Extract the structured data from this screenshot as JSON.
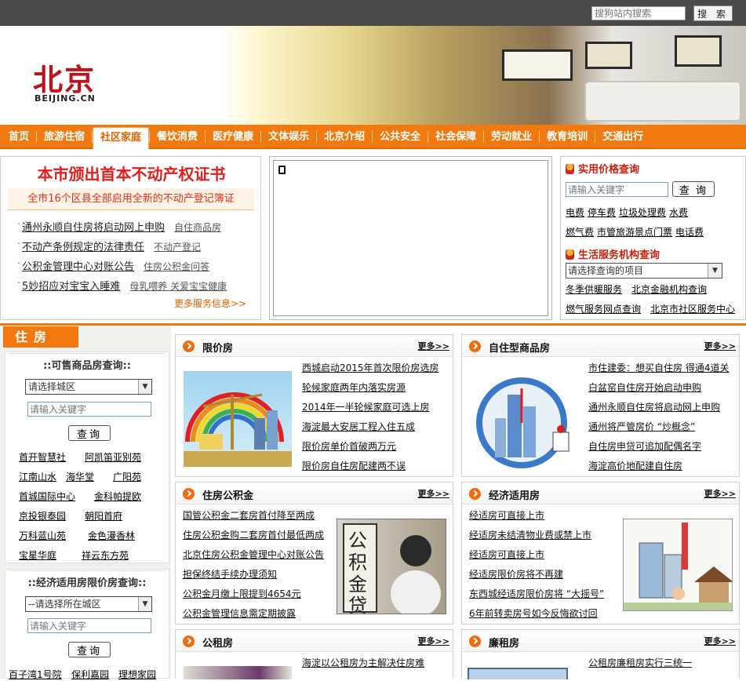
{
  "topbar": {
    "search_placeholder": "搜狗站内搜索",
    "search_button": "搜 索"
  },
  "logo": {
    "cn": "北京",
    "en": "BEIJING.CN"
  },
  "nav": [
    "首页",
    "旅游住宿",
    "社区家庭",
    "餐饮消费",
    "医疗健康",
    "文体娱乐",
    "北京介绍",
    "公共安全",
    "社会保障",
    "劳动就业",
    "教育培训",
    "交通出行"
  ],
  "nav_active": "社区家庭",
  "news": {
    "headline": "本市颁出首本不动产权证书",
    "subline": "全市16个区县全部启用全新的不动产登记簿证",
    "rows": [
      {
        "main": "通州永顺自住房将启动网上申购",
        "sub": "自住商品房"
      },
      {
        "main": "不动产条例规定的法律责任",
        "sub": "不动产登记"
      },
      {
        "main": "公积金管理中心对账公告",
        "sub": "住房公积金问答"
      },
      {
        "main": "5妙招应对宝宝入睡难",
        "sub": "母乳喂养 关爱宝宝健康"
      }
    ],
    "more": "更多服务信息>>"
  },
  "right": {
    "price_title": "实用价格查询",
    "price_placeholder": "请输入关键字",
    "price_button": "查 询",
    "price_links": [
      "电费",
      "停车费",
      "垃圾处理费",
      "水费",
      "燃气费",
      "市管旅游景点门票",
      "电话费"
    ],
    "org_title": "生活服务机构查询",
    "org_select": "请选择查询的项目",
    "org_links": [
      "冬季供暖服务",
      "北京金融机构查询",
      "燃气服务网点查询",
      "北京市社区服务中心"
    ]
  },
  "housing": {
    "tab": "住房",
    "box1": {
      "title": "::可售商品房查询::",
      "select": "请选择城区",
      "placeholder": "请输入关键字",
      "button": "查询",
      "links": [
        [
          "首开智慧社",
          "阿凯笛亚别苑"
        ],
        [
          "江南山水",
          "海华堂",
          "广阳苑"
        ],
        [
          "首城国际中心",
          "金科帕提欧"
        ],
        [
          "京投银泰园",
          "朝阳首府"
        ],
        [
          "万科蓝山苑",
          "金色漫香林"
        ],
        [
          "宝星华庭",
          "祥云东方苑"
        ]
      ]
    },
    "box2": {
      "title": "::经济适用房限价房查询::",
      "select": "--请选择所在城区",
      "placeholder": "请输入关键字",
      "button": "查询",
      "links": [
        [
          "百子湾1号院",
          "保利嘉园",
          "理想家园"
        ]
      ]
    }
  },
  "cards": [
    {
      "title": "限价房",
      "more": "更多>>",
      "items": [
        "西城启动2015年首次限价房选房",
        "轮候家庭两年内落实房源",
        "2014年一半轮候家庭可选上房",
        "海淀最大安居工程入住五成",
        "限价房单价首破两万元",
        "限价房自住房配建两不误"
      ]
    },
    {
      "title": "自住型商品房",
      "more": "更多>>",
      "items": [
        "市住建委：想买自住房 得通4道关",
        "白盆窑自住房开始启动申购",
        "通州永顺自住房将启动网上申购",
        "通州将严管房价 “炒概念”",
        "自住房申贷可追加配偶名字",
        "海淀高价地配建自住房"
      ]
    },
    {
      "title": "住房公积金",
      "more": "更多>>",
      "items": [
        "国管公积金二套房首付降至两成",
        "住房公积金购二套房首付最低两成",
        "北京住房公积金管理中心对账公告",
        "担保终结手续办理须知",
        "公积金月缴上限提到4654元",
        "公积金管理信息需定期披露"
      ],
      "img_text": "公积金贷款"
    },
    {
      "title": "经济适用房",
      "more": "更多>>",
      "items": [
        "经适房可直接上市",
        "经适房未结清物业费或禁上市",
        "经适房可直接上市",
        "经适房限价房将不再建",
        "东西城经适房限价房将 “大摇号”",
        "6年前转卖房号如今反悔欲讨回"
      ]
    },
    {
      "title": "公租房",
      "more": "更多>>",
      "items": [
        "海淀以公租房为主解决住房难"
      ]
    },
    {
      "title": "廉租房",
      "more": "更多>>",
      "items": [
        "公租房廉租房实行三统一"
      ]
    }
  ]
}
